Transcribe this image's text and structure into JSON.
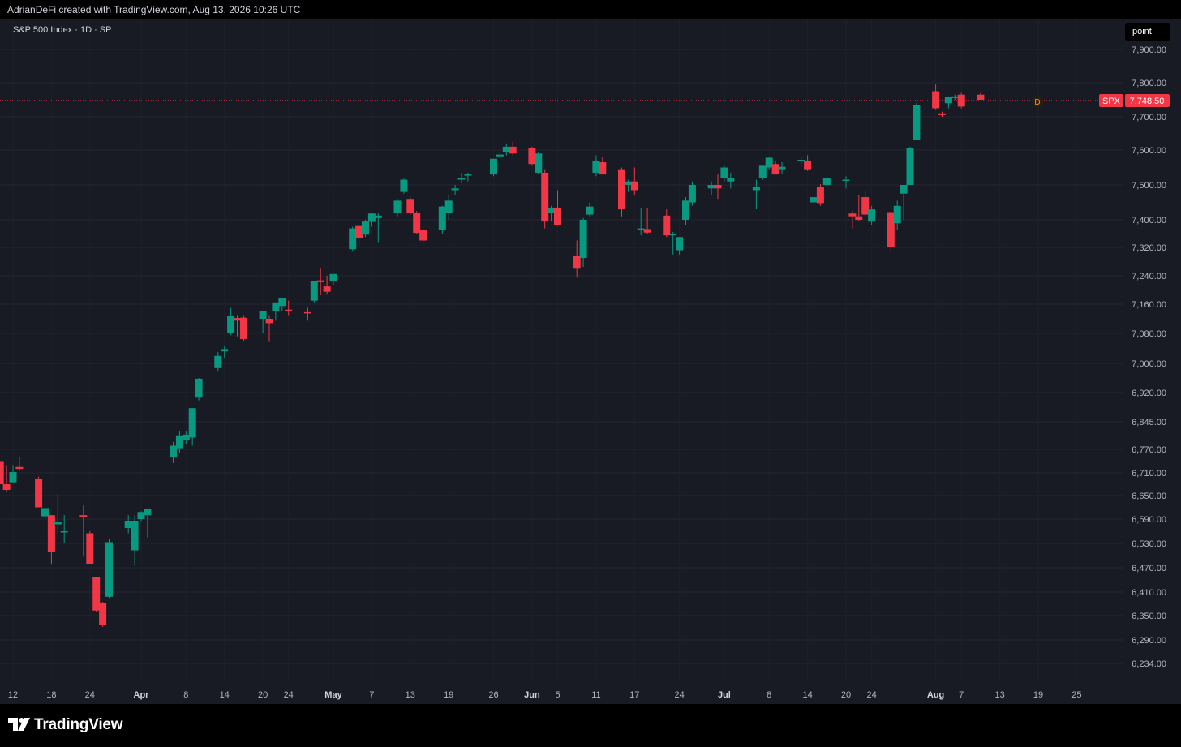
{
  "header": {
    "attribution": "AdrianDeFi created with TradingView.com, Aug 13, 2026 10:26 UTC"
  },
  "chart_header": {
    "symbol_line": "S&P 500 Index · 1D · SP",
    "point_label": "point"
  },
  "price_tag": {
    "symbol": "SPX",
    "value": "7,748.50",
    "marker": "D"
  },
  "footer": {
    "brand": "TradingView"
  },
  "colors": {
    "up": "#089981",
    "down": "#f23645",
    "background": "#191b24",
    "grid": "#232632",
    "text": "#b2b5be"
  },
  "chart_data": {
    "type": "candlestick",
    "y_ticks": [
      {
        "value": 6234,
        "label": "6,234.00"
      },
      {
        "value": 6290,
        "label": "6,290.00"
      },
      {
        "value": 6350,
        "label": "6,350.00"
      },
      {
        "value": 6410,
        "label": "6,410.00"
      },
      {
        "value": 6470,
        "label": "6,470.00"
      },
      {
        "value": 6530,
        "label": "6,530.00"
      },
      {
        "value": 6590,
        "label": "6,590.00"
      },
      {
        "value": 6650,
        "label": "6,650.00"
      },
      {
        "value": 6710,
        "label": "6,710.00"
      },
      {
        "value": 6770,
        "label": "6,770.00"
      },
      {
        "value": 6845,
        "label": "6,845.00"
      },
      {
        "value": 6920,
        "label": "6,920.00"
      },
      {
        "value": 7000,
        "label": "7,000.00"
      },
      {
        "value": 7080,
        "label": "7,080.00"
      },
      {
        "value": 7160,
        "label": "7,160.00"
      },
      {
        "value": 7240,
        "label": "7,240.00"
      },
      {
        "value": 7320,
        "label": "7,320.00"
      },
      {
        "value": 7400,
        "label": "7,400.00"
      },
      {
        "value": 7500,
        "label": "7,500.00"
      },
      {
        "value": 7600,
        "label": "7,600.00"
      },
      {
        "value": 7700,
        "label": "7,700.00"
      },
      {
        "value": 7800,
        "label": "7,800.00"
      },
      {
        "value": 7900,
        "label": "7,900.00"
      }
    ],
    "x_ticks": [
      {
        "date": "2026-03-12",
        "label": "12",
        "bold": false
      },
      {
        "date": "2026-03-18",
        "label": "18",
        "bold": false
      },
      {
        "date": "2026-03-24",
        "label": "24",
        "bold": false
      },
      {
        "date": "2026-04-01",
        "label": "Apr",
        "bold": true
      },
      {
        "date": "2026-04-08",
        "label": "8",
        "bold": false
      },
      {
        "date": "2026-04-14",
        "label": "14",
        "bold": false
      },
      {
        "date": "2026-04-20",
        "label": "20",
        "bold": false
      },
      {
        "date": "2026-04-24",
        "label": "24",
        "bold": false
      },
      {
        "date": "2026-05-01",
        "label": "May",
        "bold": true
      },
      {
        "date": "2026-05-07",
        "label": "7",
        "bold": false
      },
      {
        "date": "2026-05-13",
        "label": "13",
        "bold": false
      },
      {
        "date": "2026-05-19",
        "label": "19",
        "bold": false
      },
      {
        "date": "2026-05-26",
        "label": "26",
        "bold": false
      },
      {
        "date": "2026-06-01",
        "label": "Jun",
        "bold": true
      },
      {
        "date": "2026-06-05",
        "label": "5",
        "bold": false
      },
      {
        "date": "2026-06-11",
        "label": "11",
        "bold": false
      },
      {
        "date": "2026-06-17",
        "label": "17",
        "bold": false
      },
      {
        "date": "2026-06-24",
        "label": "24",
        "bold": false
      },
      {
        "date": "2026-07-01",
        "label": "Jul",
        "bold": true
      },
      {
        "date": "2026-07-08",
        "label": "8",
        "bold": false
      },
      {
        "date": "2026-07-14",
        "label": "14",
        "bold": false
      },
      {
        "date": "2026-07-20",
        "label": "20",
        "bold": false
      },
      {
        "date": "2026-07-24",
        "label": "24",
        "bold": false
      },
      {
        "date": "2026-08-03",
        "label": "Aug",
        "bold": true
      },
      {
        "date": "2026-08-07",
        "label": "7",
        "bold": false
      },
      {
        "date": "2026-08-13",
        "label": "13",
        "bold": false
      },
      {
        "date": "2026-08-19",
        "label": "19",
        "bold": false
      },
      {
        "date": "2026-08-25",
        "label": "25",
        "bold": false
      }
    ],
    "last_price": 7748.5,
    "candles": [
      {
        "date": "2026-03-10",
        "o": 6740,
        "h": 6740,
        "l": 6680,
        "c": 6680
      },
      {
        "date": "2026-03-11",
        "o": 6680,
        "h": 6730,
        "l": 6660,
        "c": 6665
      },
      {
        "date": "2026-03-12",
        "o": 6685,
        "h": 6730,
        "l": 6685,
        "c": 6712
      },
      {
        "date": "2026-03-13",
        "o": 6725,
        "h": 6750,
        "l": 6715,
        "c": 6720
      },
      {
        "date": "2026-03-16",
        "o": 6695,
        "h": 6700,
        "l": 6620,
        "c": 6620
      },
      {
        "date": "2026-03-17",
        "o": 6597,
        "h": 6630,
        "l": 6560,
        "c": 6618
      },
      {
        "date": "2026-03-18",
        "o": 6600,
        "h": 6600,
        "l": 6480,
        "c": 6510
      },
      {
        "date": "2026-03-19",
        "o": 6577,
        "h": 6655,
        "l": 6553,
        "c": 6582
      },
      {
        "date": "2026-03-20",
        "o": 6558,
        "h": 6600,
        "l": 6530,
        "c": 6560
      },
      {
        "date": "2026-03-23",
        "o": 6600,
        "h": 6625,
        "l": 6500,
        "c": 6595
      },
      {
        "date": "2026-03-24",
        "o": 6555,
        "h": 6560,
        "l": 6480,
        "c": 6480
      },
      {
        "date": "2026-03-25",
        "o": 6448,
        "h": 6448,
        "l": 6360,
        "c": 6363
      },
      {
        "date": "2026-03-26",
        "o": 6383,
        "h": 6385,
        "l": 6322,
        "c": 6327
      },
      {
        "date": "2026-03-27",
        "o": 6398,
        "h": 6540,
        "l": 6395,
        "c": 6533
      },
      {
        "date": "2026-03-30",
        "o": 6568,
        "h": 6600,
        "l": 6555,
        "c": 6586
      },
      {
        "date": "2026-03-31",
        "o": 6513,
        "h": 6600,
        "l": 6475,
        "c": 6586
      },
      {
        "date": "2026-04-01",
        "o": 6590,
        "h": 6610,
        "l": 6585,
        "c": 6608
      },
      {
        "date": "2026-04-02",
        "o": 6600,
        "h": 6615,
        "l": 6545,
        "c": 6615
      },
      {
        "date": "2026-04-06",
        "o": 6750,
        "h": 6790,
        "l": 6735,
        "c": 6780
      },
      {
        "date": "2026-04-07",
        "o": 6773,
        "h": 6820,
        "l": 6760,
        "c": 6808
      },
      {
        "date": "2026-04-08",
        "o": 6795,
        "h": 6820,
        "l": 6785,
        "c": 6810
      },
      {
        "date": "2026-04-09",
        "o": 6802,
        "h": 6880,
        "l": 6780,
        "c": 6880
      },
      {
        "date": "2026-04-10",
        "o": 6907,
        "h": 6960,
        "l": 6900,
        "c": 6958
      },
      {
        "date": "2026-04-13",
        "o": 6987,
        "h": 7030,
        "l": 6980,
        "c": 7020
      },
      {
        "date": "2026-04-14",
        "o": 7032,
        "h": 7045,
        "l": 7015,
        "c": 7038
      },
      {
        "date": "2026-04-15",
        "o": 7080,
        "h": 7150,
        "l": 7075,
        "c": 7127
      },
      {
        "date": "2026-04-16",
        "o": 7122,
        "h": 7130,
        "l": 7072,
        "c": 7115
      },
      {
        "date": "2026-04-17",
        "o": 7123,
        "h": 7130,
        "l": 7058,
        "c": 7065
      },
      {
        "date": "2026-04-20",
        "o": 7120,
        "h": 7140,
        "l": 7080,
        "c": 7140
      },
      {
        "date": "2026-04-21",
        "o": 7120,
        "h": 7130,
        "l": 7057,
        "c": 7108
      },
      {
        "date": "2026-04-22",
        "o": 7142,
        "h": 7160,
        "l": 7115,
        "c": 7165
      },
      {
        "date": "2026-04-23",
        "o": 7155,
        "h": 7170,
        "l": 7140,
        "c": 7177
      },
      {
        "date": "2026-04-24",
        "o": 7145,
        "h": 7170,
        "l": 7130,
        "c": 7140
      },
      {
        "date": "2026-04-27",
        "o": 7138,
        "h": 7150,
        "l": 7115,
        "c": 7135
      },
      {
        "date": "2026-04-28",
        "o": 7170,
        "h": 7225,
        "l": 7165,
        "c": 7225
      },
      {
        "date": "2026-04-29",
        "o": 7227,
        "h": 7260,
        "l": 7185,
        "c": 7222
      },
      {
        "date": "2026-04-30",
        "o": 7210,
        "h": 7240,
        "l": 7187,
        "c": 7195
      },
      {
        "date": "2026-05-01",
        "o": 7225,
        "h": 7240,
        "l": 7215,
        "c": 7245
      },
      {
        "date": "2026-05-04",
        "o": 7315,
        "h": 7380,
        "l": 7310,
        "c": 7375
      },
      {
        "date": "2026-05-05",
        "o": 7382,
        "h": 7382,
        "l": 7325,
        "c": 7348
      },
      {
        "date": "2026-05-06",
        "o": 7357,
        "h": 7400,
        "l": 7350,
        "c": 7395
      },
      {
        "date": "2026-05-07",
        "o": 7394,
        "h": 7420,
        "l": 7380,
        "c": 7418
      },
      {
        "date": "2026-05-08",
        "o": 7405,
        "h": 7420,
        "l": 7335,
        "c": 7412
      },
      {
        "date": "2026-05-11",
        "o": 7420,
        "h": 7460,
        "l": 7410,
        "c": 7455
      },
      {
        "date": "2026-05-12",
        "o": 7480,
        "h": 7520,
        "l": 7475,
        "c": 7515
      },
      {
        "date": "2026-05-13",
        "o": 7460,
        "h": 7465,
        "l": 7415,
        "c": 7420
      },
      {
        "date": "2026-05-14",
        "o": 7420,
        "h": 7425,
        "l": 7360,
        "c": 7362
      },
      {
        "date": "2026-05-15",
        "o": 7370,
        "h": 7380,
        "l": 7330,
        "c": 7340
      },
      {
        "date": "2026-05-18",
        "o": 7370,
        "h": 7440,
        "l": 7360,
        "c": 7438
      },
      {
        "date": "2026-05-19",
        "o": 7420,
        "h": 7470,
        "l": 7400,
        "c": 7455
      },
      {
        "date": "2026-05-20",
        "o": 7485,
        "h": 7500,
        "l": 7470,
        "c": 7490
      },
      {
        "date": "2026-05-21",
        "o": 7515,
        "h": 7535,
        "l": 7505,
        "c": 7520
      },
      {
        "date": "2026-05-22",
        "o": 7527,
        "h": 7535,
        "l": 7510,
        "c": 7530
      },
      {
        "date": "2026-05-26",
        "o": 7530,
        "h": 7575,
        "l": 7525,
        "c": 7575
      },
      {
        "date": "2026-05-27",
        "o": 7582,
        "h": 7598,
        "l": 7576,
        "c": 7587
      },
      {
        "date": "2026-05-28",
        "o": 7595,
        "h": 7620,
        "l": 7585,
        "c": 7610
      },
      {
        "date": "2026-05-29",
        "o": 7610,
        "h": 7625,
        "l": 7585,
        "c": 7590
      },
      {
        "date": "2026-06-01",
        "o": 7605,
        "h": 7610,
        "l": 7555,
        "c": 7560
      },
      {
        "date": "2026-06-02",
        "o": 7535,
        "h": 7595,
        "l": 7530,
        "c": 7590
      },
      {
        "date": "2026-06-03",
        "o": 7535,
        "h": 7545,
        "l": 7375,
        "c": 7395
      },
      {
        "date": "2026-06-04",
        "o": 7420,
        "h": 7440,
        "l": 7395,
        "c": 7435
      },
      {
        "date": "2026-06-05",
        "o": 7435,
        "h": 7485,
        "l": 7385,
        "c": 7385
      },
      {
        "date": "2026-06-08",
        "o": 7295,
        "h": 7340,
        "l": 7235,
        "c": 7260
      },
      {
        "date": "2026-06-09",
        "o": 7290,
        "h": 7405,
        "l": 7265,
        "c": 7400
      },
      {
        "date": "2026-06-10",
        "o": 7415,
        "h": 7450,
        "l": 7410,
        "c": 7438
      },
      {
        "date": "2026-06-11",
        "o": 7535,
        "h": 7585,
        "l": 7525,
        "c": 7570
      },
      {
        "date": "2026-06-12",
        "o": 7565,
        "h": 7580,
        "l": 7530,
        "c": 7530
      },
      {
        "date": "2026-06-15",
        "o": 7545,
        "h": 7550,
        "l": 7410,
        "c": 7430
      },
      {
        "date": "2026-06-16",
        "o": 7500,
        "h": 7515,
        "l": 7480,
        "c": 7510
      },
      {
        "date": "2026-06-17",
        "o": 7510,
        "h": 7550,
        "l": 7470,
        "c": 7485
      },
      {
        "date": "2026-06-18",
        "o": 7375,
        "h": 7435,
        "l": 7355,
        "c": 7375
      },
      {
        "date": "2026-06-19",
        "o": 7373,
        "h": 7435,
        "l": 7358,
        "c": 7363
      },
      {
        "date": "2026-06-22",
        "o": 7412,
        "h": 7430,
        "l": 7350,
        "c": 7355
      },
      {
        "date": "2026-06-23",
        "o": 7355,
        "h": 7365,
        "l": 7300,
        "c": 7360
      },
      {
        "date": "2026-06-24",
        "o": 7312,
        "h": 7350,
        "l": 7300,
        "c": 7350
      },
      {
        "date": "2026-06-25",
        "o": 7400,
        "h": 7465,
        "l": 7385,
        "c": 7455
      },
      {
        "date": "2026-06-26",
        "o": 7450,
        "h": 7510,
        "l": 7440,
        "c": 7500
      },
      {
        "date": "2026-06-29",
        "o": 7490,
        "h": 7510,
        "l": 7470,
        "c": 7500
      },
      {
        "date": "2026-06-30",
        "o": 7500,
        "h": 7530,
        "l": 7460,
        "c": 7490
      },
      {
        "date": "2026-07-01",
        "o": 7520,
        "h": 7555,
        "l": 7510,
        "c": 7550
      },
      {
        "date": "2026-07-02",
        "o": 7510,
        "h": 7535,
        "l": 7490,
        "c": 7520
      },
      {
        "date": "2026-07-06",
        "o": 7485,
        "h": 7515,
        "l": 7430,
        "c": 7495
      },
      {
        "date": "2026-07-07",
        "o": 7520,
        "h": 7555,
        "l": 7515,
        "c": 7555
      },
      {
        "date": "2026-07-08",
        "o": 7550,
        "h": 7580,
        "l": 7545,
        "c": 7578
      },
      {
        "date": "2026-07-09",
        "o": 7560,
        "h": 7568,
        "l": 7530,
        "c": 7530
      },
      {
        "date": "2026-07-10",
        "o": 7545,
        "h": 7565,
        "l": 7530,
        "c": 7552
      },
      {
        "date": "2026-07-13",
        "o": 7570,
        "h": 7580,
        "l": 7555,
        "c": 7572
      },
      {
        "date": "2026-07-14",
        "o": 7570,
        "h": 7585,
        "l": 7540,
        "c": 7545
      },
      {
        "date": "2026-07-15",
        "o": 7450,
        "h": 7495,
        "l": 7435,
        "c": 7465
      },
      {
        "date": "2026-07-16",
        "o": 7495,
        "h": 7502,
        "l": 7440,
        "c": 7448
      },
      {
        "date": "2026-07-17",
        "o": 7500,
        "h": 7515,
        "l": 7495,
        "c": 7520
      },
      {
        "date": "2026-07-20",
        "o": 7515,
        "h": 7525,
        "l": 7490,
        "c": 7515
      },
      {
        "date": "2026-07-21",
        "o": 7418,
        "h": 7425,
        "l": 7375,
        "c": 7410
      },
      {
        "date": "2026-07-22",
        "o": 7410,
        "h": 7470,
        "l": 7395,
        "c": 7400
      },
      {
        "date": "2026-07-23",
        "o": 7465,
        "h": 7480,
        "l": 7410,
        "c": 7415
      },
      {
        "date": "2026-07-24",
        "o": 7395,
        "h": 7440,
        "l": 7385,
        "c": 7430
      },
      {
        "date": "2026-07-27",
        "o": 7422,
        "h": 7425,
        "l": 7310,
        "c": 7320
      },
      {
        "date": "2026-07-28",
        "o": 7390,
        "h": 7455,
        "l": 7370,
        "c": 7440
      },
      {
        "date": "2026-07-29",
        "o": 7475,
        "h": 7495,
        "l": 7400,
        "c": 7500
      },
      {
        "date": "2026-07-30",
        "o": 7500,
        "h": 7610,
        "l": 7500,
        "c": 7605
      },
      {
        "date": "2026-07-31",
        "o": 7630,
        "h": 7740,
        "l": 7630,
        "c": 7735
      },
      {
        "date": "2026-08-03",
        "o": 7775,
        "h": 7795,
        "l": 7720,
        "c": 7725
      },
      {
        "date": "2026-08-04",
        "o": 7710,
        "h": 7715,
        "l": 7700,
        "c": 7705
      },
      {
        "date": "2026-08-05",
        "o": 7740,
        "h": 7760,
        "l": 7725,
        "c": 7758
      },
      {
        "date": "2026-08-06",
        "o": 7755,
        "h": 7765,
        "l": 7750,
        "c": 7760
      },
      {
        "date": "2026-08-07",
        "o": 7765,
        "h": 7770,
        "l": 7725,
        "c": 7730
      },
      {
        "date": "2026-08-10",
        "o": 7765,
        "h": 7770,
        "l": 7750,
        "c": 7750
      }
    ]
  }
}
